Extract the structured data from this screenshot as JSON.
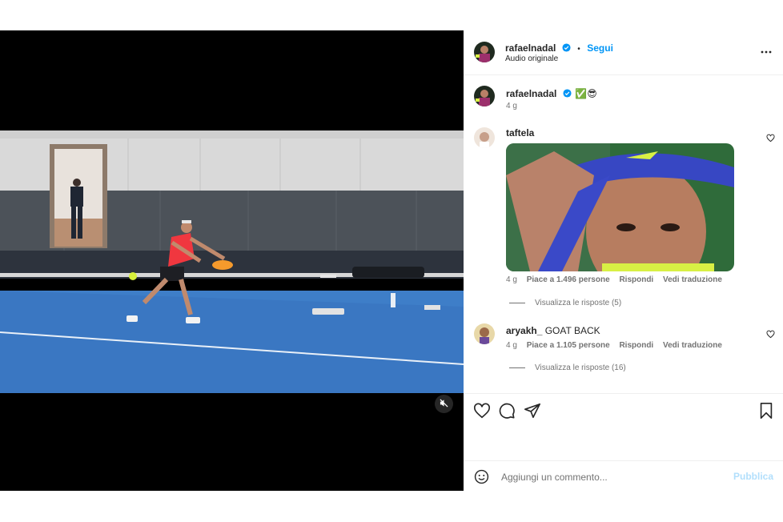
{
  "post": {
    "author": "rafaelnadal",
    "follow_label": "Segui",
    "separator": "•",
    "audio": "Audio originale"
  },
  "caption": {
    "author": "rafaelnadal",
    "emojis": "✅😎",
    "age": "4 g"
  },
  "comments": [
    {
      "author": "taftela",
      "text": "",
      "has_gif": true,
      "age": "4 g",
      "likes": "Piace a 1.496 persone",
      "reply_label": "Rispondi",
      "translate_label": "Vedi traduzione",
      "view_replies": "Visualizza le risposte (5)"
    },
    {
      "author": "aryakh_",
      "text": "GOAT BACK",
      "has_gif": false,
      "age": "4 g",
      "likes": "Piace a 1.105 persone",
      "reply_label": "Rispondi",
      "translate_label": "Vedi traduzione",
      "view_replies": "Visualizza le risposte (16)"
    }
  ],
  "add_comment": {
    "placeholder": "Aggiungi un commento...",
    "publish_label": "Pubblica"
  },
  "icons": {
    "more": "more-icon",
    "verified": "verified-badge-icon",
    "like": "heart-icon",
    "comment": "comment-icon",
    "share": "share-icon",
    "save": "bookmark-icon",
    "emoji": "emoji-icon",
    "mute": "muted-speaker-icon"
  },
  "colors": {
    "accent": "#0095f6",
    "publish_disabled": "#b2dffc",
    "muted_text": "#737373"
  }
}
